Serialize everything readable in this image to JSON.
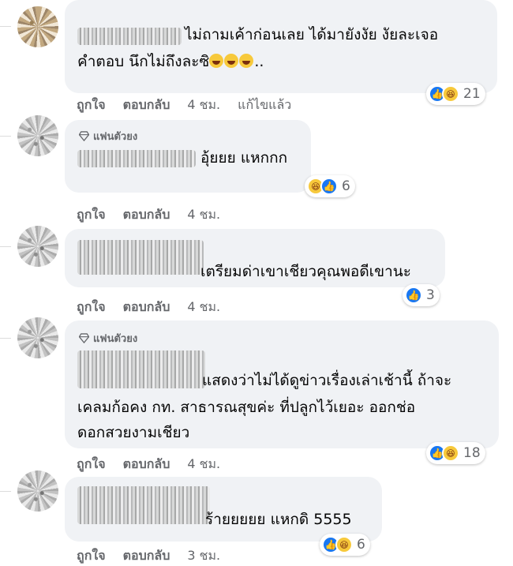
{
  "comments": [
    {
      "lines": [
        "ไม่ถามเค้าก่อนเลย ได้มายังงัย งัยละเจอ",
        "คำตอบ นึกไม่ถึงละซิ",
        ".."
      ],
      "reaction_count": "21",
      "actions": {
        "like": "ถูกใจ",
        "reply": "ตอบกลับ",
        "time": "4 ชม.",
        "edited": "แก้ไขแล้ว"
      }
    },
    {
      "badge": "แฟนตัวยง",
      "lines": [
        "อุ้ยยย แหกกก"
      ],
      "reaction_count": "6",
      "actions": {
        "like": "ถูกใจ",
        "reply": "ตอบกลับ",
        "time": "4 ชม."
      }
    },
    {
      "lines": [
        "เตรียมด่าเขาเชียวคุณพอดีเขานะ"
      ],
      "reaction_count": "3",
      "actions": {
        "like": "ถูกใจ",
        "reply": "ตอบกลับ",
        "time": "4 ชม."
      }
    },
    {
      "badge": "แฟนตัวยง",
      "lines": [
        "แสดงว่าไม่ได้ดูข่าวเรื่องเล่าเช้านี้ ถ้าจะ",
        "เคลมก้อคง กท. สาธารณสุขค่ะ ที่ปลูกไว้เยอะ ออกช่อ",
        "ดอกสวยงามเชียว"
      ],
      "reaction_count": "18",
      "actions": {
        "like": "ถูกใจ",
        "reply": "ตอบกลับ",
        "time": "4 ชม."
      }
    },
    {
      "lines": [
        "ร้ายยยยย แหกดิ 5555"
      ],
      "reaction_count": "6",
      "actions": {
        "like": "ถูกใจ",
        "reply": "ตอบกลับ",
        "time": "3 ชม."
      }
    }
  ],
  "colors": {
    "bubble": "#f0f2f5",
    "like_blue": "#1877f2",
    "haha_yellow": "#f7c93b",
    "meta_gray": "#65676b"
  },
  "icons": {
    "like": "thumbs-up-icon",
    "haha": "laughing-face-icon",
    "badge": "diamond-icon"
  }
}
